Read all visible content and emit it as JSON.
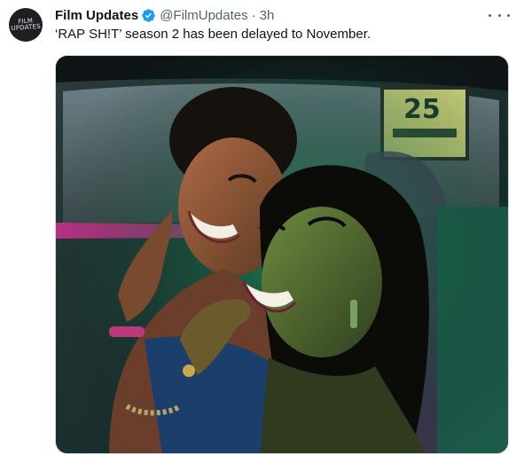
{
  "tweet": {
    "avatar_text": "FILM UPDATES",
    "display_name": "Film Updates",
    "handle": "@FilmUpdates",
    "separator": "·",
    "time": "3h",
    "text": "‘RAP SH!T’ season 2 has been delayed to November.",
    "media": {
      "sign_text": "25"
    }
  },
  "colors": {
    "verified": "#1d9bf0",
    "text": "#0f1419",
    "secondary_text": "#536471"
  },
  "icons": {
    "verified": "verified-badge-icon",
    "more": "more-options-icon"
  }
}
